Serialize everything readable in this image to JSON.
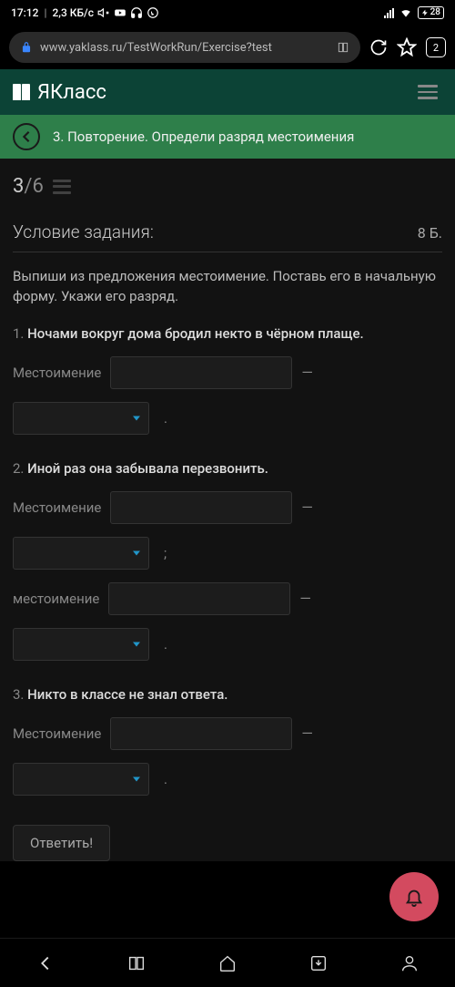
{
  "status": {
    "time": "17:12",
    "net_speed": "2,3 КБ/с",
    "battery": "28"
  },
  "browser": {
    "url": "www.yaklass.ru/TestWorkRun/Exercise?test",
    "tab_count": "2"
  },
  "app": {
    "logo_text": "ЯКласс"
  },
  "sub_header": {
    "title": "3. Повторение. Определи разряд местоимения"
  },
  "progress": {
    "current": "3",
    "sep": "/",
    "total": "6"
  },
  "condition": {
    "title": "Условие задания:",
    "points": "8 Б."
  },
  "instruction": "Выпиши из предложения местоимение. Поставь его в начальную форму. Укажи его разряд.",
  "questions": [
    {
      "num": "1.",
      "text": "Ночами вокруг дома бродил некто в чёрном плаще.",
      "label1": "Местоимение",
      "dash": "—",
      "punct": "."
    },
    {
      "num": "2.",
      "text": "Иной раз она забывала перезвонить.",
      "label1": "Местоимение",
      "label2": "местоимение",
      "dash": "—",
      "punct1": ";",
      "punct2": "."
    },
    {
      "num": "3.",
      "text": "Никто в классе не знал ответа.",
      "label1": "Местоимение",
      "dash": "—",
      "punct": "."
    }
  ],
  "submit": "Ответить!"
}
